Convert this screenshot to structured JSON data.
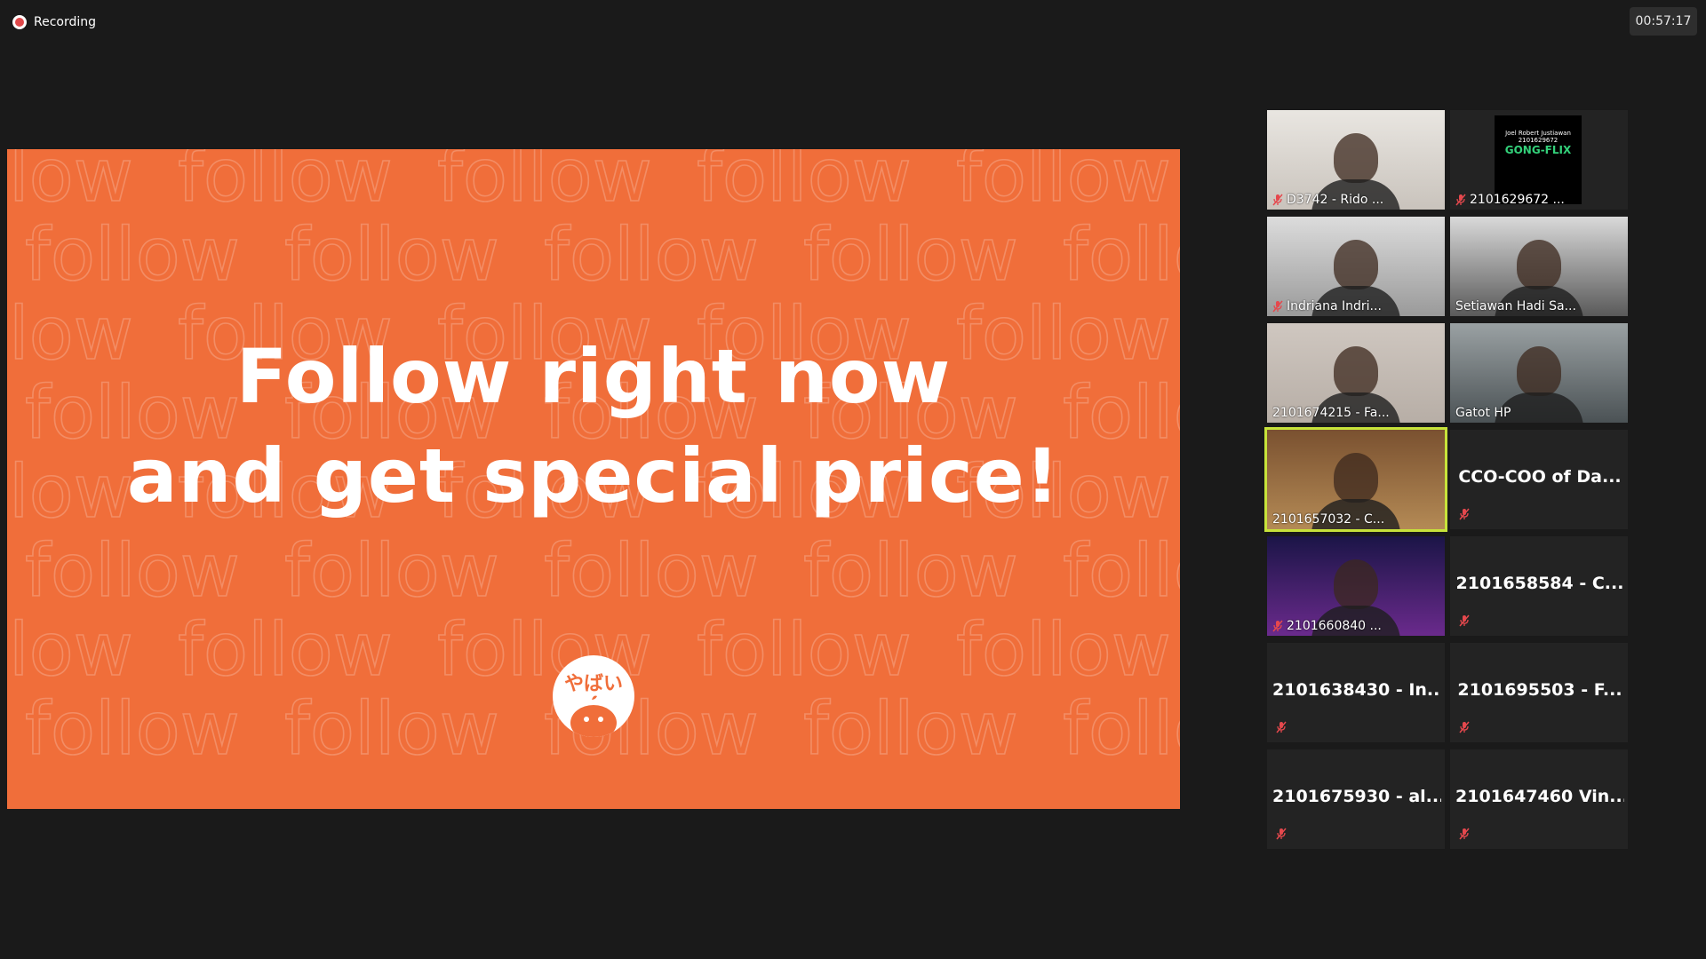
{
  "recording": {
    "label": "Recording"
  },
  "timer": {
    "value": "00:57:17"
  },
  "slide": {
    "headline_line1": "Follow right now",
    "headline_line2": "and get special price!",
    "pattern_word": "follow",
    "logo_text": "やばい",
    "bg_color": "#f06e3a"
  },
  "participants": [
    {
      "name": "D3742 - Rido ...",
      "video": true,
      "muted": true
    },
    {
      "name": "2101629672 ...",
      "video": true,
      "muted": true
    },
    {
      "name": "Indriana Indri...",
      "video": true,
      "muted": true
    },
    {
      "name": "Setiawan Hadi Sa...",
      "video": true,
      "muted": false
    },
    {
      "name": "2101674215 - Fa...",
      "video": true,
      "muted": false
    },
    {
      "name": "Gatot HP",
      "video": true,
      "muted": false
    },
    {
      "name": "2101657032 - C...",
      "video": true,
      "muted": false,
      "active": true
    },
    {
      "name": "CCO-COO of Da...",
      "video": false,
      "muted": true
    },
    {
      "name": "2101660840 ...",
      "video": true,
      "muted": true
    },
    {
      "name": "2101658584 - C...",
      "video": false,
      "muted": true
    },
    {
      "name": "2101638430 - In...",
      "video": false,
      "muted": true
    },
    {
      "name": "2101695503 - F...",
      "video": false,
      "muted": true
    },
    {
      "name": "2101675930 - al...",
      "video": false,
      "muted": true
    },
    {
      "name": "2101647460 Vin...",
      "video": false,
      "muted": true
    }
  ],
  "video_card_text": {
    "line1": "Joel Robert Justiawan",
    "line2": "2101629672",
    "line3": "GONG-FLIX"
  }
}
